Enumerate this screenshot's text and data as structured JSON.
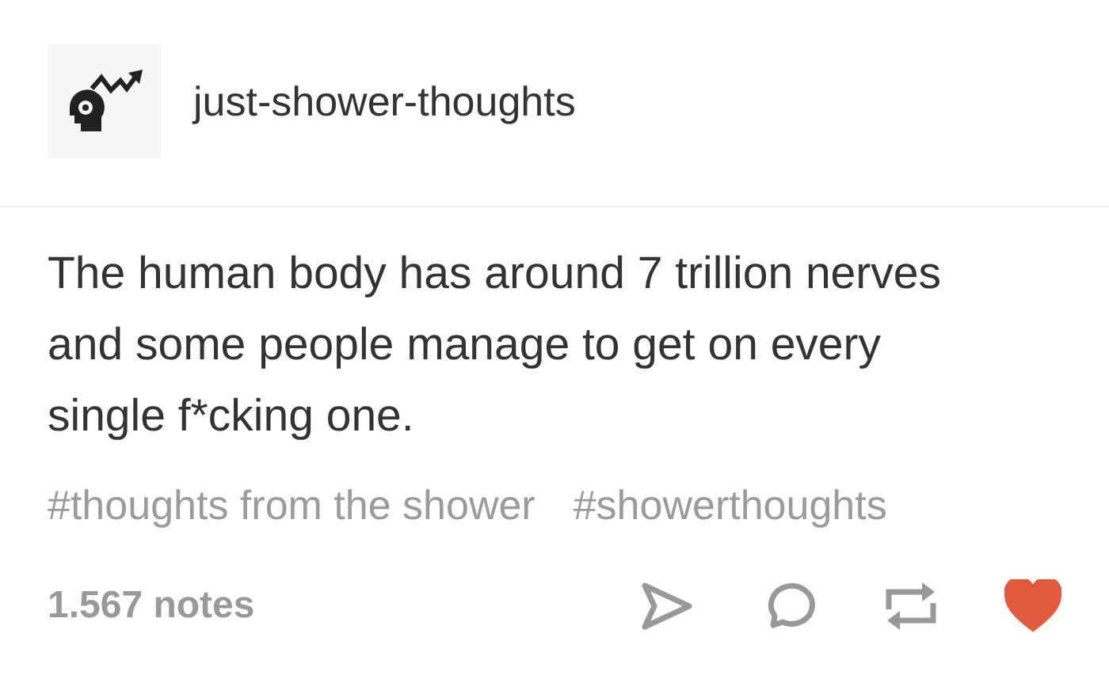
{
  "blog": {
    "name": "just-shower-thoughts"
  },
  "post": {
    "text": "The human body has around 7 trillion nerves and some people manage to get on every single f*cking one."
  },
  "tags": [
    "#thoughts from the shower",
    "#showerthoughts"
  ],
  "footer": {
    "notes": "1.567 notes",
    "liked": true
  }
}
